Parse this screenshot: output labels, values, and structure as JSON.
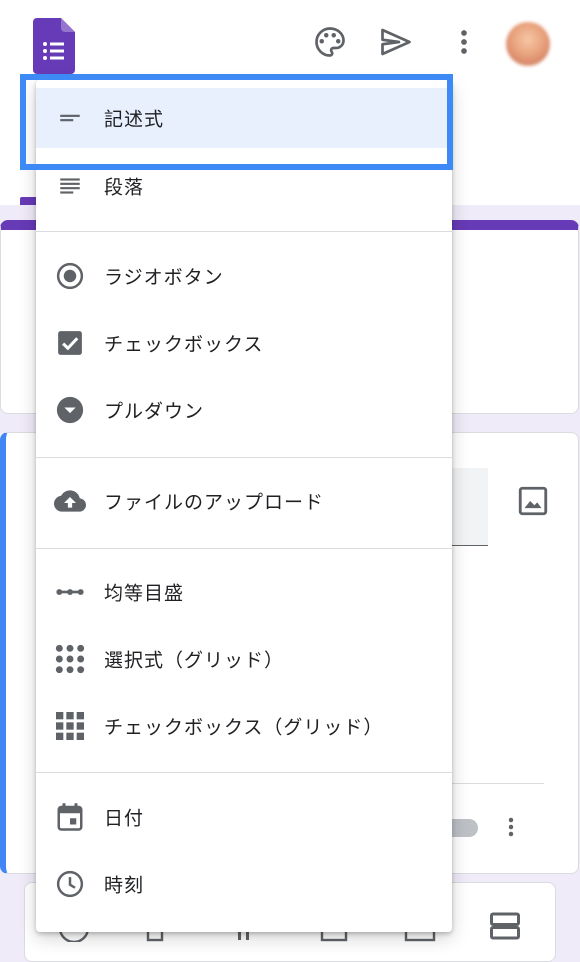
{
  "colors": {
    "brand": "#673ab7",
    "accent": "#4285f4",
    "highlight": "#3d8af7",
    "selected_bg": "#e8f0fe",
    "icon": "#5f6368"
  },
  "header": {
    "logo_icon": "google-forms-icon",
    "actions": [
      {
        "icon": "palette-icon"
      },
      {
        "icon": "send-icon"
      },
      {
        "icon": "more-vert-icon"
      }
    ],
    "avatar": "avatar"
  },
  "question_type_menu": {
    "selected_index": 0,
    "groups": [
      [
        {
          "label": "記述式",
          "icon": "short-text-icon"
        },
        {
          "label": "段落",
          "icon": "paragraph-icon"
        }
      ],
      [
        {
          "label": "ラジオボタン",
          "icon": "radio-button-icon"
        },
        {
          "label": "チェックボックス",
          "icon": "checkbox-icon"
        },
        {
          "label": "プルダウン",
          "icon": "dropdown-icon"
        }
      ],
      [
        {
          "label": "ファイルのアップロード",
          "icon": "cloud-upload-icon"
        }
      ],
      [
        {
          "label": "均等目盛",
          "icon": "linear-scale-icon"
        },
        {
          "label": "選択式（グリッド）",
          "icon": "grid-dots-icon"
        },
        {
          "label": "チェックボックス（グリッド）",
          "icon": "grid-squares-icon"
        }
      ],
      [
        {
          "label": "日付",
          "icon": "calendar-icon"
        },
        {
          "label": "時刻",
          "icon": "clock-icon"
        }
      ]
    ]
  },
  "question_card": {
    "image_icon": "image-icon",
    "more_icon": "more-vert-icon"
  },
  "bottom_toolbar": {
    "section_icon": "section-icon"
  }
}
